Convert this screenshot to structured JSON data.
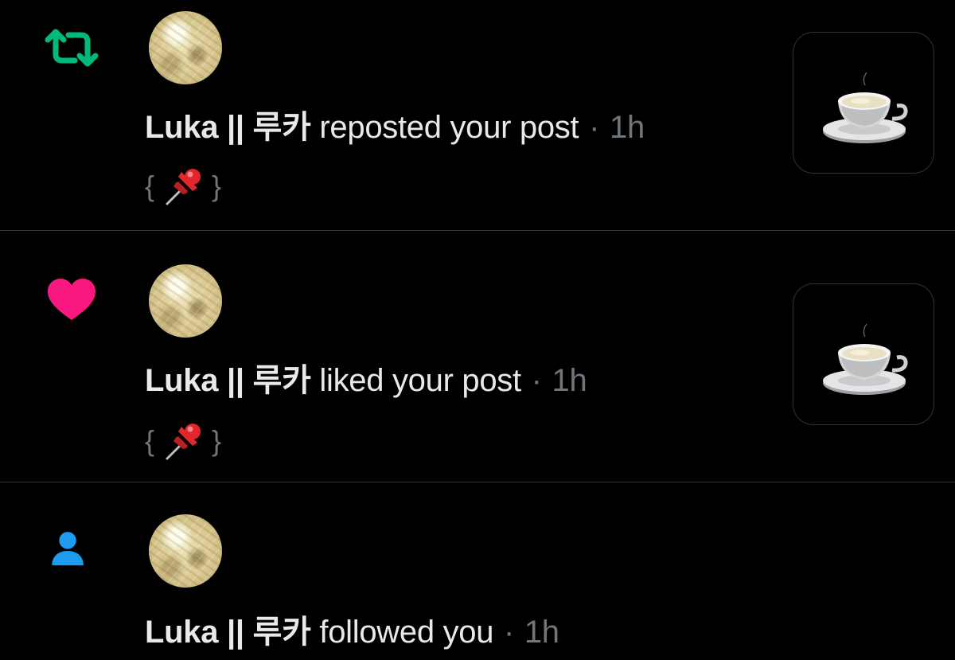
{
  "colors": {
    "background": "#000000",
    "divider": "#2f3336",
    "text_primary": "#e7e9ea",
    "text_secondary": "#71767b",
    "repost_green": "#00ba7c",
    "like_pink": "#f91880",
    "follow_blue": "#1d9bf0"
  },
  "notifications": [
    {
      "type_icon": "repost-icon",
      "user_name": "Luka || 루카",
      "action": "reposted your post",
      "separator": "·",
      "time": "1h",
      "preview_open": "{",
      "preview_emoji": "pushpin-emoji",
      "preview_close": "}",
      "thumbnail": "coffee-cup-image"
    },
    {
      "type_icon": "heart-icon",
      "user_name": "Luka || 루카",
      "action": "liked your post",
      "separator": "·",
      "time": "1h",
      "preview_open": "{",
      "preview_emoji": "pushpin-emoji",
      "preview_close": "}",
      "thumbnail": "coffee-cup-image"
    },
    {
      "type_icon": "person-icon",
      "user_name": "Luka || 루카",
      "action": "followed you",
      "separator": "·",
      "time": "1h"
    }
  ]
}
